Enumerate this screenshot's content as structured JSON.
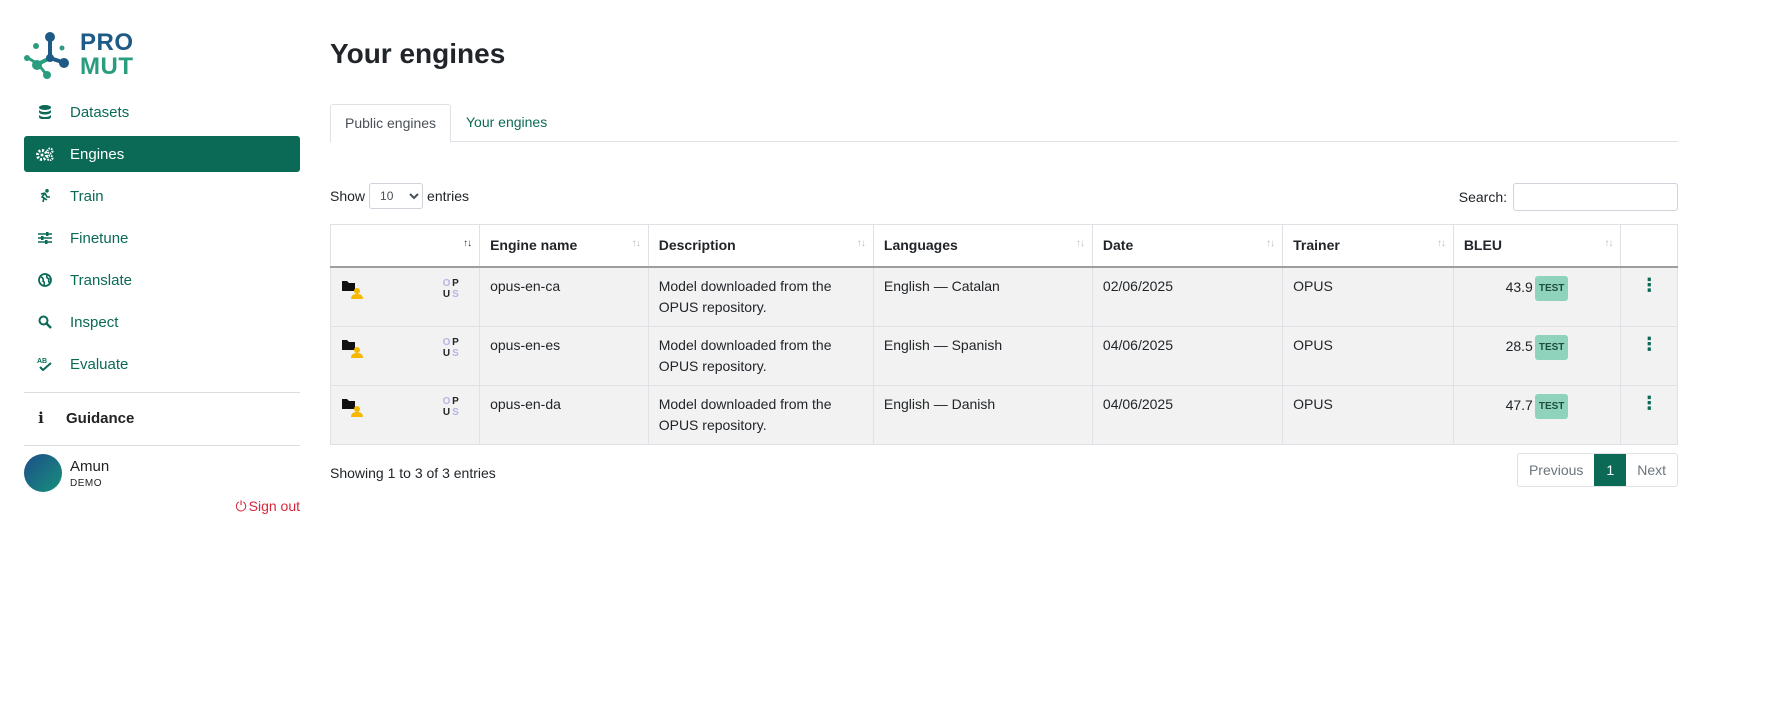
{
  "logo": {
    "line1": "PRO",
    "line2": "MUT"
  },
  "sidebar": {
    "items": [
      {
        "label": "Datasets",
        "icon": "database-icon"
      },
      {
        "label": "Engines",
        "icon": "gears-icon",
        "active": true
      },
      {
        "label": "Train",
        "icon": "running-icon"
      },
      {
        "label": "Finetune",
        "icon": "sliders-icon"
      },
      {
        "label": "Translate",
        "icon": "globe-icon"
      },
      {
        "label": "Inspect",
        "icon": "search-icon"
      },
      {
        "label": "Evaluate",
        "icon": "spellcheck-icon"
      }
    ],
    "guidance": "Guidance",
    "user": {
      "name": "Amun",
      "role": "DEMO"
    },
    "signout": "Sign out"
  },
  "main": {
    "title": "Your engines",
    "tabs": [
      {
        "label": "Public engines",
        "active": true
      },
      {
        "label": "Your engines"
      }
    ],
    "length": {
      "show": "Show",
      "value": "10",
      "entries": "entries"
    },
    "search": {
      "label": "Search:"
    },
    "table": {
      "headers": [
        "",
        "Engine name",
        "Description",
        "Languages",
        "Date",
        "Trainer",
        "BLEU",
        ""
      ],
      "rows": [
        {
          "name": "opus-en-ca",
          "description": "Model downloaded from the OPUS repository.",
          "languages": "English — Catalan",
          "date": "02/06/2025",
          "trainer": "OPUS",
          "bleu": "43.9",
          "badge": "TEST"
        },
        {
          "name": "opus-en-es",
          "description": "Model downloaded from the OPUS repository.",
          "languages": "English — Spanish",
          "date": "04/06/2025",
          "trainer": "OPUS",
          "bleu": "28.5",
          "badge": "TEST"
        },
        {
          "name": "opus-en-da",
          "description": "Model downloaded from the OPUS repository.",
          "languages": "English — Danish",
          "date": "04/06/2025",
          "trainer": "OPUS",
          "bleu": "47.7",
          "badge": "TEST"
        }
      ]
    },
    "info": "Showing 1 to 3 of 3 entries",
    "pager": {
      "previous": "Previous",
      "current": "1",
      "next": "Next"
    }
  },
  "colors": {
    "accent": "#0a6a56",
    "danger": "#d9263a",
    "badge": "#8fd3bd"
  }
}
